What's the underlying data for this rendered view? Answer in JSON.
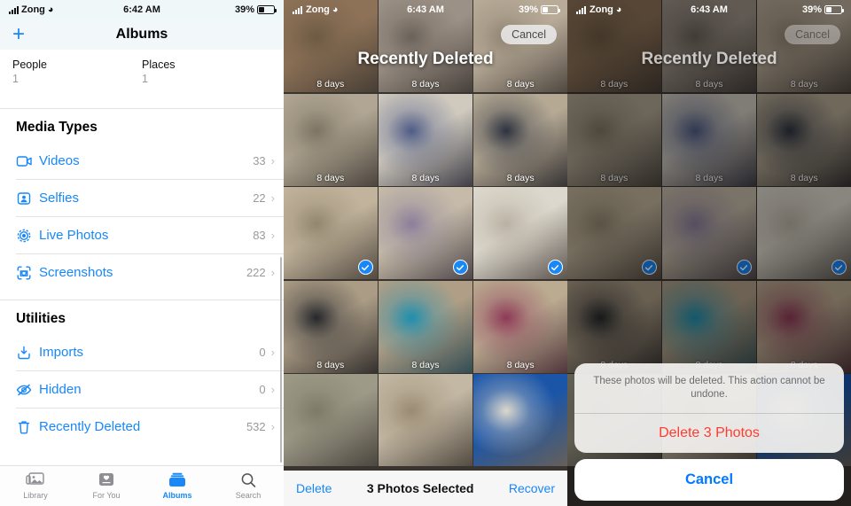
{
  "panel_albums": {
    "status": {
      "carrier": "Zong",
      "time": "6:42 AM",
      "battery": "39%"
    },
    "nav": {
      "add_label": "+",
      "title": "Albums"
    },
    "people_places": [
      {
        "name": "People",
        "count": "1"
      },
      {
        "name": "Places",
        "count": "1"
      }
    ],
    "sections": [
      {
        "title": "Media Types",
        "rows": [
          {
            "icon": "video-icon",
            "label": "Videos",
            "count": "33"
          },
          {
            "icon": "selfies-icon",
            "label": "Selfies",
            "count": "22"
          },
          {
            "icon": "live-photo-icon",
            "label": "Live Photos",
            "count": "83"
          },
          {
            "icon": "screenshot-icon",
            "label": "Screenshots",
            "count": "222"
          }
        ]
      },
      {
        "title": "Utilities",
        "rows": [
          {
            "icon": "import-icon",
            "label": "Imports",
            "count": "0"
          },
          {
            "icon": "hidden-icon",
            "label": "Hidden",
            "count": "0"
          },
          {
            "icon": "trash-icon",
            "label": "Recently Deleted",
            "count": "532"
          }
        ]
      }
    ],
    "tabs": [
      {
        "icon": "library-icon",
        "label": "Library",
        "active": false
      },
      {
        "icon": "foryou-icon",
        "label": "For You",
        "active": false
      },
      {
        "icon": "albums-icon",
        "label": "Albums",
        "active": true
      },
      {
        "icon": "search-icon",
        "label": "Search",
        "active": false
      }
    ]
  },
  "panel_recently_deleted": {
    "status": {
      "carrier": "Zong",
      "time": "6:43 AM",
      "battery": "39%"
    },
    "title": "Recently Deleted",
    "cancel_label": "Cancel",
    "toolbar": {
      "delete_label": "Delete",
      "selection_label": "3 Photos Selected",
      "recover_label": "Recover"
    },
    "days_label": "8 days",
    "cells": [
      {
        "id": 1,
        "selected": false,
        "show_days": true,
        "c1": "#8d7257",
        "c2": "#6d5a44",
        "subject": "necklace-on-card"
      },
      {
        "id": 2,
        "selected": false,
        "show_days": true,
        "c1": "#9c9186",
        "c2": "#6b625a",
        "subject": "packaged-jewelry"
      },
      {
        "id": 3,
        "selected": false,
        "show_days": true,
        "c1": "#b8ab98",
        "c2": "#8e8271",
        "subject": "gold-hairpins"
      },
      {
        "id": 4,
        "selected": false,
        "show_days": true,
        "c1": "#b0a693",
        "c2": "#7e7463",
        "subject": "pearl-strands"
      },
      {
        "id": 5,
        "selected": false,
        "show_days": true,
        "c1": "#cfc9be",
        "c2": "#4f5c86",
        "subject": "bow-in-bag"
      },
      {
        "id": 6,
        "selected": false,
        "show_days": true,
        "c1": "#b5a994",
        "c2": "#2e3340",
        "subject": "black-bead-bracelet"
      },
      {
        "id": 7,
        "selected": true,
        "show_days": false,
        "c1": "#c2b49c",
        "c2": "#93866f",
        "subject": "gold-chain-on-card"
      },
      {
        "id": 8,
        "selected": true,
        "show_days": false,
        "c1": "#c6bba8",
        "c2": "#8b7f9b",
        "subject": "purple-hair-ties"
      },
      {
        "id": 9,
        "selected": true,
        "show_days": false,
        "c1": "#ddd8cd",
        "c2": "#b9b2a4",
        "subject": "white-ribbon-brooch"
      },
      {
        "id": 10,
        "selected": false,
        "show_days": true,
        "c1": "#ab9c85",
        "c2": "#26282c",
        "subject": "black-flower-necklace"
      },
      {
        "id": 11,
        "selected": false,
        "show_days": true,
        "c1": "#b09f86",
        "c2": "#1f8fae",
        "subject": "turquoise-necklace"
      },
      {
        "id": 12,
        "selected": false,
        "show_days": true,
        "c1": "#bbab91",
        "c2": "#8e3a57",
        "subject": "star-hair-ties"
      },
      {
        "id": 13,
        "selected": false,
        "show_days": false,
        "c1": "#9e9a88",
        "c2": "#7d7a68",
        "subject": "gold-bangles"
      },
      {
        "id": 14,
        "selected": false,
        "show_days": false,
        "c1": "#c3b8a4",
        "c2": "#9a8b72",
        "subject": "brooch-on-card"
      },
      {
        "id": 15,
        "selected": false,
        "show_days": false,
        "c1": "#1b55a8",
        "c2": "#dcd8cc",
        "subject": "pearl-sheet-package"
      }
    ]
  },
  "panel_confirm": {
    "status": {
      "carrier": "Zong",
      "time": "6:43 AM",
      "battery": "39%"
    },
    "title": "Recently Deleted",
    "cancel_label": "Cancel",
    "days_label": "8 days",
    "alert": {
      "message": "These photos will be deleted. This action cannot be undone.",
      "destructive_label": "Delete 3 Photos",
      "cancel_label": "Cancel"
    }
  },
  "colors": {
    "accent": "#1887f7",
    "destructive": "#ff3b30",
    "muted": "#9a9a9a"
  }
}
